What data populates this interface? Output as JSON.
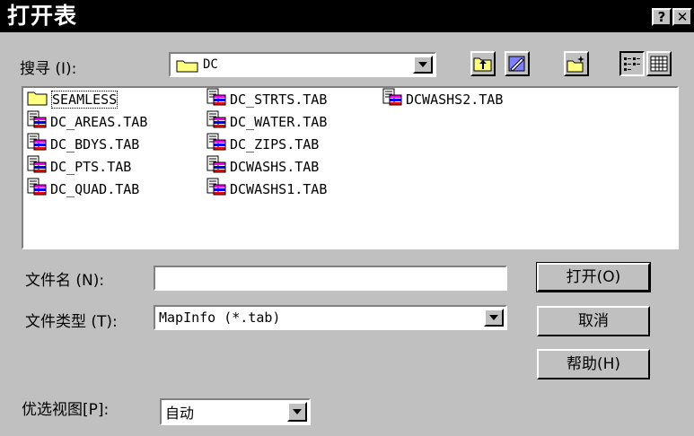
{
  "window": {
    "title": "打开表",
    "help_button": "?",
    "close_button": "✕"
  },
  "look_in": {
    "label": "搜寻 (I):",
    "folder": "DC"
  },
  "toolbar": {
    "icons": [
      "up-one-level-icon",
      "desktop-icon",
      "new-folder-icon",
      "list-view-icon",
      "details-view-icon"
    ]
  },
  "files": {
    "col1": [
      "SEAMLESS",
      "DC_AREAS.TAB",
      "DC_BDYS.TAB",
      "DC_PTS.TAB",
      "DC_QUAD.TAB"
    ],
    "col2": [
      "DC_STRTS.TAB",
      "DC_WATER.TAB",
      "DC_ZIPS.TAB",
      "DCWASHS.TAB",
      "DCWASHS1.TAB"
    ],
    "col3": [
      "DCWASHS2.TAB"
    ]
  },
  "filename": {
    "label": "文件名 (N):",
    "value": ""
  },
  "filetype": {
    "label": "文件类型 (T):",
    "value": "MapInfo (*.tab)"
  },
  "preferred_view": {
    "label": "优选视图[P]:",
    "value": "自动"
  },
  "buttons": {
    "open": "打开(O)",
    "cancel": "取消",
    "help": "帮助(H)"
  },
  "colors": {
    "face": "#c0c0c0",
    "titlebar": "#000000",
    "folder": "#ffff80"
  }
}
